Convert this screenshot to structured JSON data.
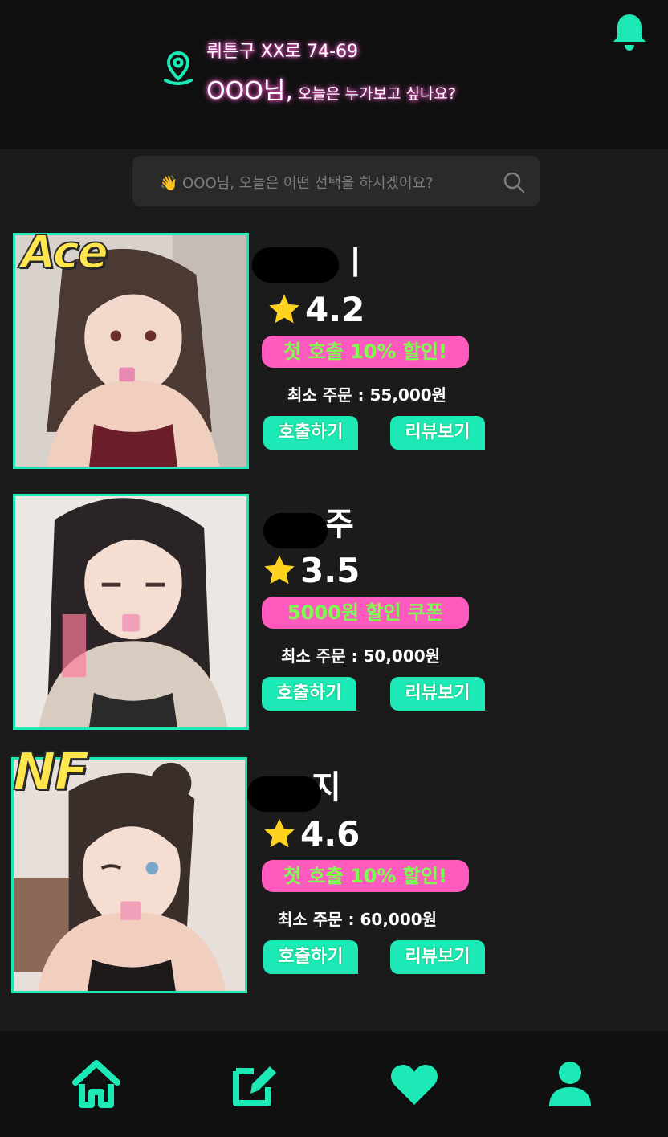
{
  "header": {
    "address": "뤼튼구 XX로 74-69",
    "greeting_name": "OOO님,",
    "greeting_text": " 오늘은 누가보고 싶나요?"
  },
  "search": {
    "placeholder": "👋 OOO님, 오늘은 어떤 선택을 하시겠어요?"
  },
  "colors": {
    "accent": "#1de9b6",
    "promo_bg": "#ff5bbf",
    "promo_text": "#7bff4f",
    "badge": "#ffe64d"
  },
  "cards": [
    {
      "badge": "Ace",
      "name": "ㅣ",
      "rating": "4.2",
      "promo": "첫 호출 10% 할인!",
      "min_order": "최소 주문 : 55,000원",
      "call_label": "호출하기",
      "review_label": "리뷰보기"
    },
    {
      "badge": "",
      "name": "주",
      "rating": "3.5",
      "promo": "5000원 할인 쿠폰",
      "min_order": "최소 주문 : 50,000원",
      "call_label": "호출하기",
      "review_label": "리뷰보기"
    },
    {
      "badge": "NF",
      "name": "지",
      "rating": "4.6",
      "promo": "첫 호출 10% 할인!",
      "min_order": "최소 주문 : 60,000원",
      "call_label": "호출하기",
      "review_label": "리뷰보기"
    }
  ],
  "nav": {
    "items": [
      "home-icon",
      "edit-icon",
      "heart-icon",
      "user-icon"
    ]
  }
}
